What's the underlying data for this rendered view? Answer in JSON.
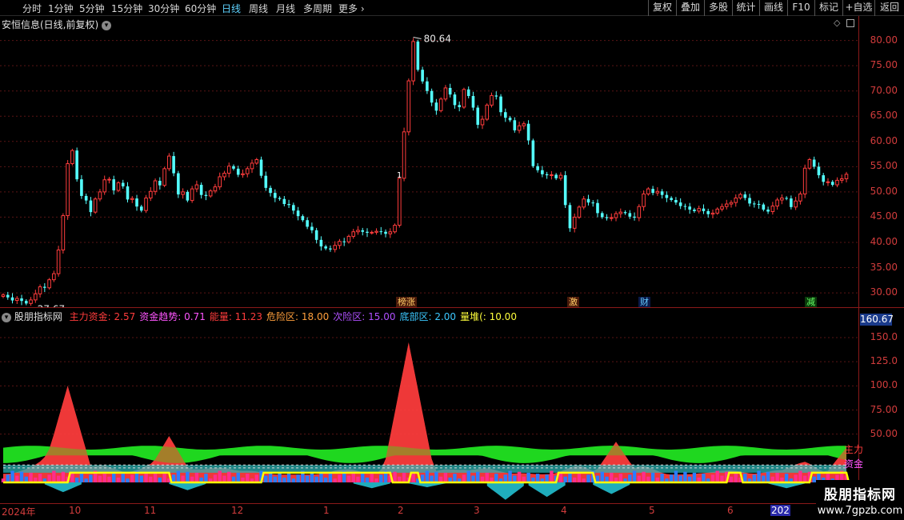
{
  "toolbar": {
    "periods": [
      "分时",
      "1分钟",
      "5分钟",
      "15分钟",
      "30分钟",
      "60分钟",
      "日线",
      "周线",
      "月线",
      "多周期",
      "更多"
    ],
    "active_period": "日线",
    "more_arrow": "›",
    "right_buttons": [
      "复权",
      "叠加",
      "多股",
      "统计",
      "画线",
      "F10",
      "标记",
      "+自选",
      "返回"
    ]
  },
  "main_chart": {
    "title": "安恒信息(日线,前复权)",
    "high_label": "80.64",
    "low_label": "27.67",
    "marker_1": "1",
    "y_ticks": [
      "80.00",
      "75.00",
      "70.00",
      "65.00",
      "60.00",
      "55.00",
      "50.00",
      "45.00",
      "40.00",
      "35.00",
      "30.00"
    ],
    "events": [
      "榜涨",
      "激",
      "财",
      "减"
    ]
  },
  "indicator": {
    "name": "股朋指标网",
    "items": [
      {
        "label": "主力资金:",
        "value": "2.57",
        "color": "#ff3c3c"
      },
      {
        "label": "资金趋势:",
        "value": "0.71",
        "color": "#ff55ff"
      },
      {
        "label": "能量:",
        "value": "11.23",
        "color": "#ff3c3c"
      },
      {
        "label": "危险区:",
        "value": "18.00",
        "color": "#ff9f3c"
      },
      {
        "label": "次险区:",
        "value": "15.00",
        "color": "#b050ff"
      },
      {
        "label": "底部区:",
        "value": "2.00",
        "color": "#3cc8ff"
      },
      {
        "label": "量堆(:",
        "value": "10.00",
        "color": "#ffff3c"
      }
    ],
    "y_ticks": [
      "150.0",
      "125.0",
      "100.0",
      "75.00",
      "50.00"
    ],
    "current_value": "160.67",
    "right_labels": [
      "主力",
      "资金"
    ]
  },
  "x_axis": {
    "ticks": [
      "2024年",
      "10",
      "11",
      "12",
      "1",
      "2",
      "3",
      "4",
      "5",
      "6"
    ],
    "current": "202"
  },
  "watermark": {
    "name": "股朋指标网",
    "url": "www.7gpzb.com"
  },
  "colors": {
    "up": "#ff3c3c",
    "down": "#54ffff",
    "axis": "#d23c3c",
    "border": "#8b1a1a"
  },
  "chart_data": {
    "type": "candlestick",
    "ylim": [
      27,
      82
    ],
    "close": [
      29.6,
      29.1,
      28.5,
      28.9,
      28.4,
      27.9,
      28.6,
      29.8,
      31.2,
      31.0,
      32.6,
      33.8,
      38.5,
      45.3,
      55.6,
      58.2,
      52.5,
      49.2,
      48.3,
      46.0,
      48.6,
      50.0,
      52.4,
      52.5,
      50.3,
      51.8,
      51.1,
      48.5,
      48.7,
      47.1,
      46.3,
      48.8,
      50.1,
      52.2,
      51.3,
      54.6,
      57.1,
      53.7,
      49.5,
      50.0,
      48.3,
      50.6,
      51.4,
      49.4,
      49.2,
      50.2,
      51.0,
      53.0,
      53.7,
      55.1,
      54.6,
      53.4,
      53.6,
      54.6,
      55.7,
      56.4,
      53.2,
      50.8,
      49.8,
      48.8,
      48.6,
      47.6,
      47.4,
      46.3,
      45.2,
      44.4,
      43.1,
      42.4,
      40.5,
      39.2,
      38.8,
      38.6,
      39.4,
      40.2,
      40.1,
      41.2,
      42.1,
      42.4,
      42.1,
      41.9,
      42.0,
      42.2,
      42.1,
      41.7,
      42.1,
      43.4,
      52.7,
      61.9,
      72.0,
      79.8,
      74.2,
      71.9,
      70.0,
      67.7,
      66.1,
      68.4,
      70.6,
      69.3,
      67.2,
      66.8,
      70.3,
      69.0,
      66.7,
      63.3,
      64.4,
      67.2,
      69.1,
      68.9,
      65.8,
      64.7,
      64.2,
      62.2,
      63.1,
      63.5,
      60.2,
      55.1,
      54.3,
      53.5,
      53.3,
      53.4,
      52.7,
      53.3,
      47.4,
      42.8,
      45.0,
      47.0,
      48.6,
      47.9,
      47.8,
      45.8,
      45.0,
      44.8,
      44.9,
      45.7,
      46.0,
      45.8,
      45.1,
      44.9,
      47.1,
      49.6,
      50.6,
      49.8,
      50.1,
      49.4,
      48.8,
      48.4,
      47.9,
      47.2,
      47.1,
      46.5,
      46.2,
      46.7,
      46.2,
      45.6,
      45.8,
      46.6,
      47.1,
      47.6,
      47.9,
      48.8,
      49.5,
      48.8,
      47.7,
      47.6,
      47.5,
      46.5,
      46.1,
      47.2,
      48.4,
      48.8,
      48.7,
      47.0,
      48.2,
      49.6,
      54.7,
      56.4,
      55.0,
      53.3,
      52.0,
      52.0,
      51.4,
      52.3,
      52.6,
      53.5
    ]
  }
}
